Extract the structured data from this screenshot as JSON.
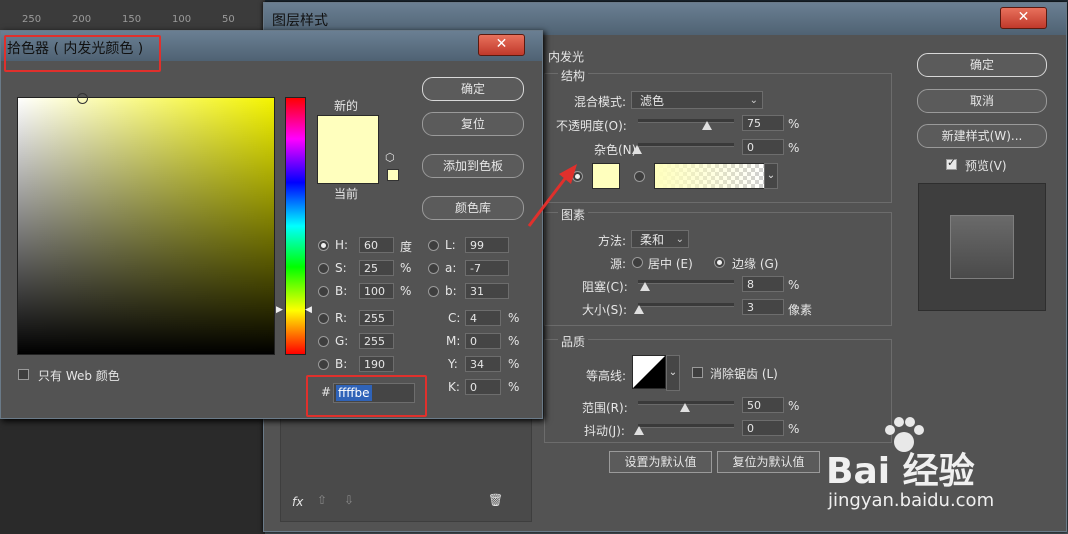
{
  "ruler": {
    "ticks": [
      "250",
      "200",
      "150",
      "100",
      "50"
    ]
  },
  "layer_style": {
    "title": "图层样式",
    "close_icon": "✕",
    "section_title": "内发光",
    "structure": {
      "title": "结构",
      "blend_mode_label": "混合模式:",
      "blend_mode_value": "滤色",
      "opacity_label": "不透明度(O):",
      "opacity_value": "75",
      "opacity_unit": "%",
      "noise_label": "杂色(N):",
      "noise_value": "0",
      "noise_unit": "%",
      "glow_color": "#ffffbe"
    },
    "elements": {
      "title": "图素",
      "method_label": "方法:",
      "method_value": "柔和",
      "source_label": "源:",
      "source_center": "居中 (E)",
      "source_edge": "边缘 (G)",
      "choke_label": "阻塞(C):",
      "choke_value": "8",
      "choke_unit": "%",
      "size_label": "大小(S):",
      "size_value": "3",
      "size_unit": "像素"
    },
    "quality": {
      "title": "品质",
      "contour_label": "等高线:",
      "antialias_label": "消除锯齿 (L)",
      "range_label": "范围(R):",
      "range_value": "50",
      "range_unit": "%",
      "jitter_label": "抖动(J):",
      "jitter_value": "0",
      "jitter_unit": "%"
    },
    "set_default": "设置为默认值",
    "reset_default": "复位为默认值",
    "buttons": {
      "ok": "确定",
      "cancel": "取消",
      "new_style": "新建样式(W)...",
      "preview": "预览(V)"
    },
    "bottom_icons": {
      "fx": "fx",
      "up": "⇧",
      "down": "⇩",
      "trash": "🗑"
    }
  },
  "color_picker": {
    "title": "拾色器 ( 内发光颜色 )",
    "close_icon": "✕",
    "new_label": "新的",
    "current_label": "当前",
    "new_color": "#ffffbe",
    "current_color": "#ffffbe",
    "buttons": {
      "ok": "确定",
      "reset": "复位",
      "add_swatch": "添加到色板",
      "library": "颜色库"
    },
    "web_only_label": "只有 Web 颜色",
    "hsb": [
      {
        "label": "H:",
        "value": "60",
        "unit": "度"
      },
      {
        "label": "S:",
        "value": "25",
        "unit": "%"
      },
      {
        "label": "B:",
        "value": "100",
        "unit": "%"
      }
    ],
    "rgb": [
      {
        "label": "R:",
        "value": "255"
      },
      {
        "label": "G:",
        "value": "255"
      },
      {
        "label": "B:",
        "value": "190"
      }
    ],
    "lab": [
      {
        "label": "L:",
        "value": "99"
      },
      {
        "label": "a:",
        "value": "-7"
      },
      {
        "label": "b:",
        "value": "31"
      }
    ],
    "cmyk": [
      {
        "label": "C:",
        "value": "4",
        "unit": "%"
      },
      {
        "label": "M:",
        "value": "0",
        "unit": "%"
      },
      {
        "label": "Y:",
        "value": "34",
        "unit": "%"
      },
      {
        "label": "K:",
        "value": "0",
        "unit": "%"
      }
    ],
    "hex_prefix": "#",
    "hex_value": "ffffbe"
  },
  "watermark": {
    "brand": "Bai 经验",
    "url": "jingyan.baidu.com"
  },
  "colors": {
    "annotation_red": "#e0302c",
    "title_bar": "#5a6e80"
  }
}
